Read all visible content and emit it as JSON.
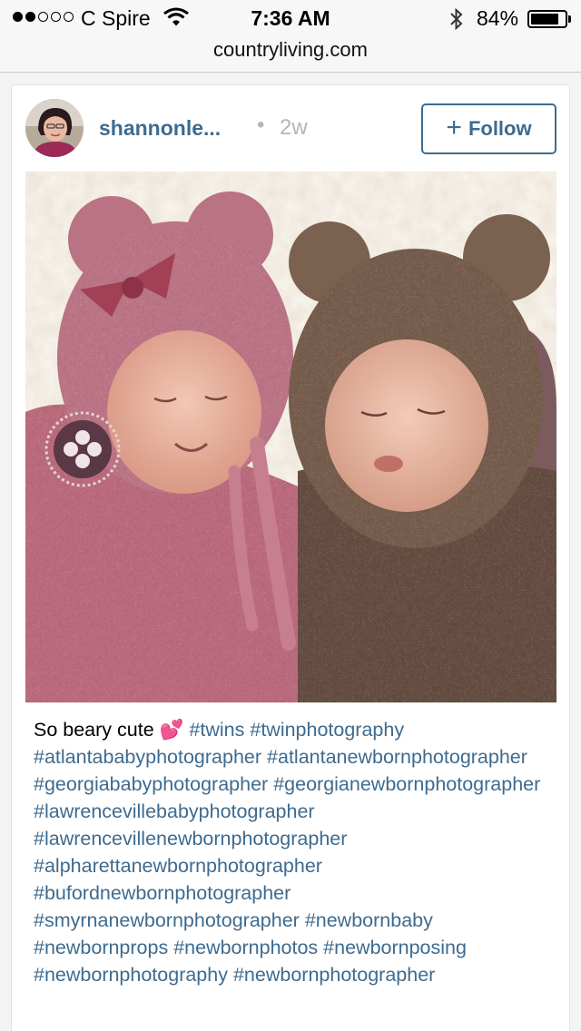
{
  "status_bar": {
    "carrier": "C Spire",
    "signal_bars_filled": 2,
    "signal_bars_total": 5,
    "time": "7:36 AM",
    "battery_percent": "84%",
    "battery_level": 0.84,
    "icons": [
      "wifi-icon",
      "bluetooth-icon",
      "battery-icon"
    ]
  },
  "browser": {
    "url": "countryliving.com"
  },
  "post": {
    "username": "shannonle...",
    "separator": "•",
    "age": "2w",
    "follow_plus": "+",
    "follow_label": "Follow",
    "caption_text": "So beary cute",
    "caption_emoji": "💕",
    "hashtags": [
      "#twins",
      "#twinphotography",
      "#atlantababyphotographer",
      "#atlantanewbornphotographer",
      "#georgiababyphotographer",
      "#georgianewbornphotographer",
      "#lawrencevillebabyphotographer",
      "#lawrencevillenewbornphotographer",
      "#alpharettanewbornphotographer",
      "#bufordnewbornphotographer",
      "#smyrnanewbornphotographer",
      "#newbornbaby",
      "#newbornprops",
      "#newbornphotos",
      "#newbornposing",
      "#newbornphotography",
      "#newbornphotographer"
    ]
  },
  "colors": {
    "link_blue": "#3e6b8f",
    "muted_gray": "#b5b5b5",
    "pink_knit": "#b86a7c",
    "brown_knit": "#6d5446"
  }
}
